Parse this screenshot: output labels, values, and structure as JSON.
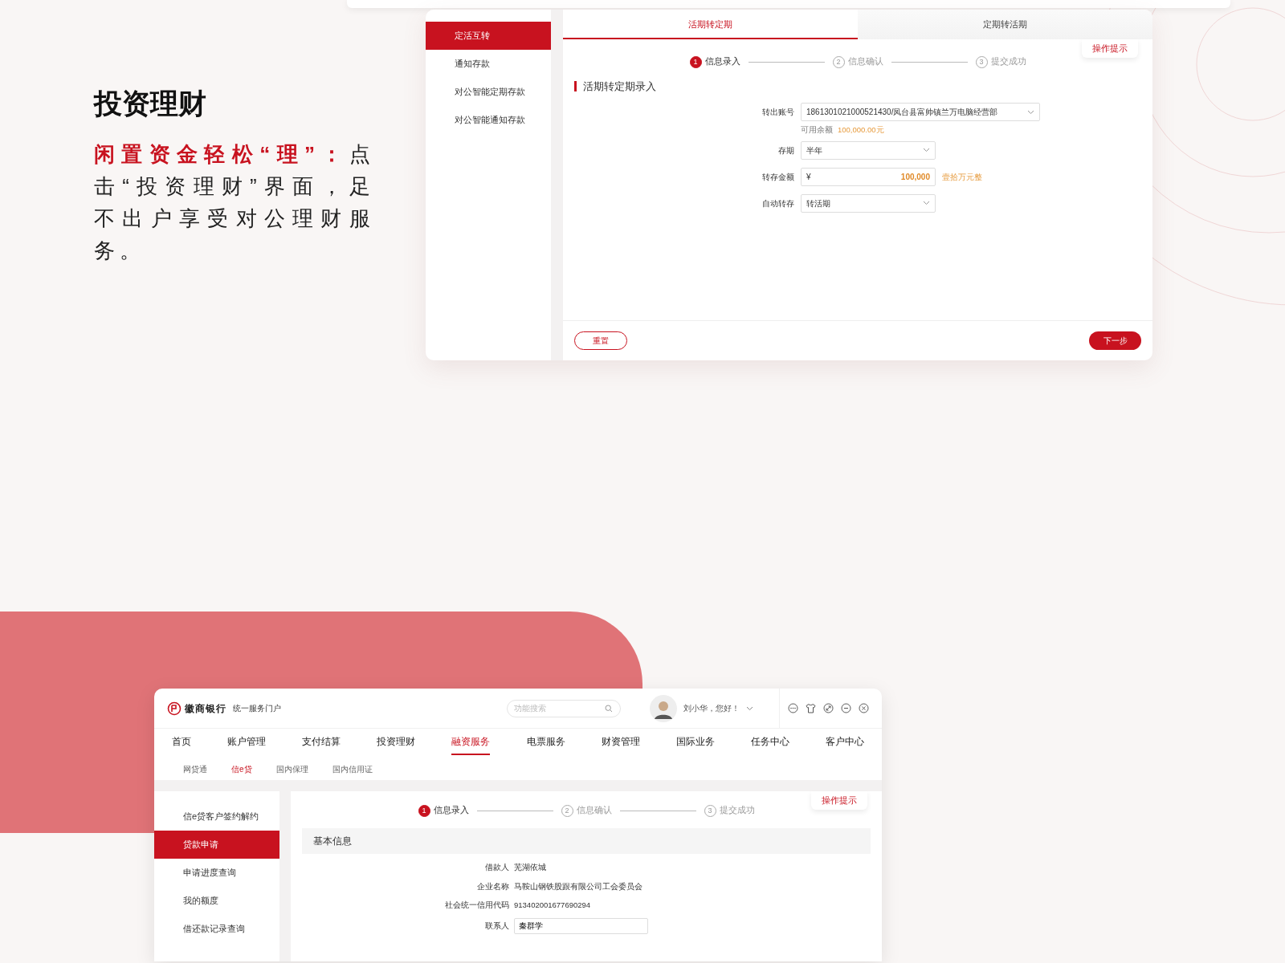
{
  "intro": {
    "title": "投资理财",
    "lead": "闲置资金轻松“理”：",
    "text": "点击“投资理财”界面，足不出户享受对公理财服务。"
  },
  "deposit": {
    "sidebar": [
      {
        "label": "定活互转",
        "selected": true
      },
      {
        "label": "通知存款",
        "selected": false
      },
      {
        "label": "对公智能定期存款",
        "selected": false
      },
      {
        "label": "对公智能通知存款",
        "selected": false
      }
    ],
    "tabs": [
      {
        "label": "活期转定期",
        "selected": true
      },
      {
        "label": "定期转活期",
        "selected": false
      }
    ],
    "help": "操作提示",
    "steps": [
      {
        "number": "1",
        "label": "信息录入",
        "active": true
      },
      {
        "number": "2",
        "label": "信息确认",
        "active": false
      },
      {
        "number": "3",
        "label": "提交成功",
        "active": false
      }
    ],
    "section_title": "活期转定期录入",
    "fields": [
      {
        "kind": "account",
        "label": "转出账号",
        "value": "1861301021000521430/凤台县富帅镇兰万电脑经营部",
        "note_label": "可用余额",
        "note_value": "100,000.00元"
      },
      {
        "kind": "select",
        "label": "存期",
        "value": "半年"
      },
      {
        "kind": "amount",
        "label": "转存金额",
        "currency": "¥",
        "value": "100,000",
        "words": "壹拾万元整"
      },
      {
        "kind": "select",
        "label": "自动转存",
        "value": "转活期"
      }
    ],
    "reset": "重置",
    "next": "下一步"
  },
  "portal": {
    "bank_name": "徽商银行",
    "portal_title": "统一服务门户",
    "search": {
      "placeholder": "功能搜索"
    },
    "greeting": "刘小华，您好！",
    "nav": [
      {
        "label": "首页",
        "selected": false
      },
      {
        "label": "账户管理",
        "selected": false
      },
      {
        "label": "支付结算",
        "selected": false
      },
      {
        "label": "投资理财",
        "selected": false
      },
      {
        "label": "融资服务",
        "selected": true
      },
      {
        "label": "电票服务",
        "selected": false
      },
      {
        "label": "财资管理",
        "selected": false
      },
      {
        "label": "国际业务",
        "selected": false
      },
      {
        "label": "任务中心",
        "selected": false
      },
      {
        "label": "客户中心",
        "selected": false
      }
    ],
    "subnav": [
      {
        "label": "网贷通",
        "selected": false
      },
      {
        "label": "信e贷",
        "selected": true
      },
      {
        "label": "国内保理",
        "selected": false
      },
      {
        "label": "国内信用证",
        "selected": false
      }
    ],
    "sidebar": [
      {
        "label": "信e贷客户签约解约",
        "selected": false
      },
      {
        "label": "贷款申请",
        "selected": true
      },
      {
        "label": "申请进度查询",
        "selected": false
      },
      {
        "label": "我的额度",
        "selected": false
      },
      {
        "label": "借还款记录查询",
        "selected": false
      }
    ],
    "help": "操作提示",
    "steps": [
      {
        "number": "1",
        "label": "信息录入",
        "active": true
      },
      {
        "number": "2",
        "label": "信息确认",
        "active": false
      },
      {
        "number": "3",
        "label": "提交成功",
        "active": false
      }
    ],
    "section_title": "基本信息",
    "rows": [
      {
        "kind": "text",
        "label": "借款人",
        "value": "芜湖依城"
      },
      {
        "kind": "text",
        "label": "企业名称",
        "value": "马鞍山钢铁股跟有限公司工会委员会"
      },
      {
        "kind": "text",
        "label": "社会统一信用代码",
        "value": "913402001677690294"
      },
      {
        "kind": "input",
        "label": "联系人",
        "value": "秦群学"
      }
    ]
  }
}
